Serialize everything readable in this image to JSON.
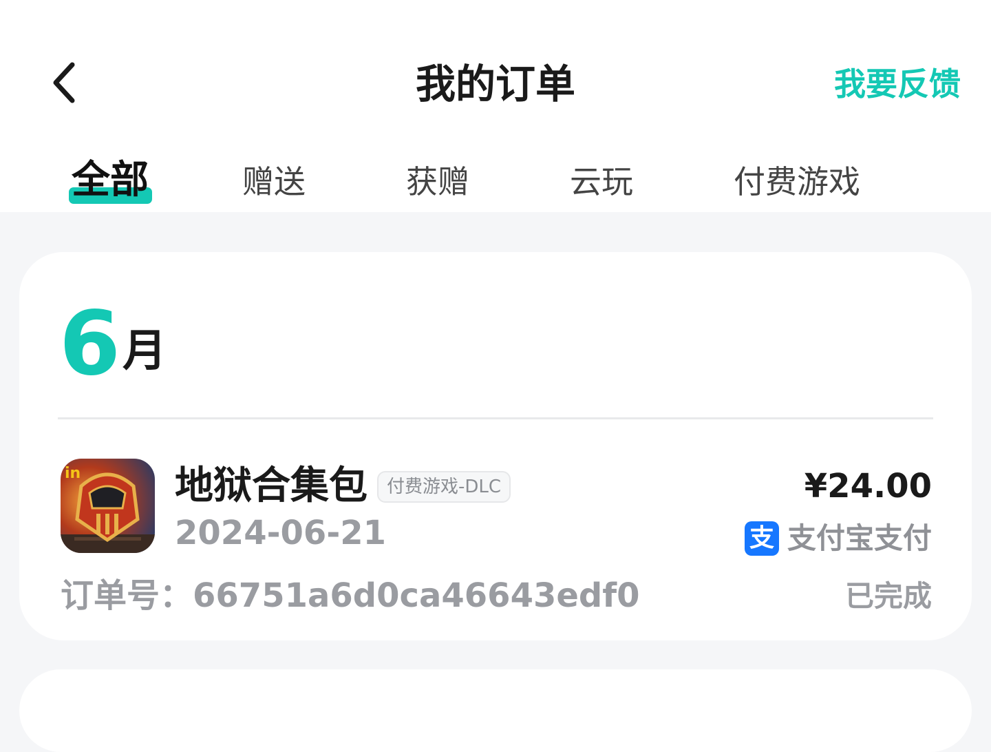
{
  "header": {
    "title": "我的订单",
    "feedback_label": "我要反馈",
    "back_icon": "chevron-left-icon"
  },
  "tabs": [
    {
      "label": "全部",
      "active": true
    },
    {
      "label": "赠送",
      "active": false
    },
    {
      "label": "获赠",
      "active": false
    },
    {
      "label": "云玩",
      "active": false
    },
    {
      "label": "付费游戏",
      "active": false
    }
  ],
  "accent_color": "#14c8b4",
  "month_group": {
    "month_number": "6",
    "month_unit": "月"
  },
  "orders": [
    {
      "name": "地狱合集包",
      "tag": "付费游戏-DLC",
      "date": "2024-06-21",
      "order_number": "订单号：66751a6d0ca46643edf0",
      "price": "¥24.00",
      "payment_method": "支付宝支付",
      "payment_icon": "alipay-icon",
      "payment_icon_glyph": "支",
      "payment_icon_color": "#1677ff",
      "status": "已完成"
    }
  ]
}
